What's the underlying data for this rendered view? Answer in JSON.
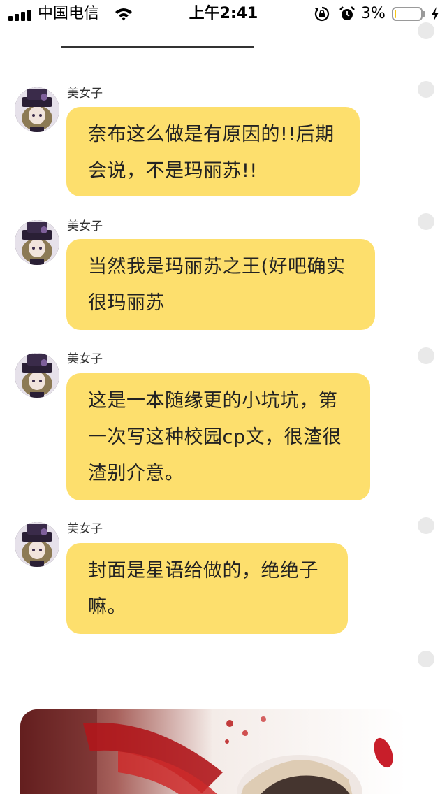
{
  "status_bar": {
    "carrier": "中国电信",
    "time": "上午2:41",
    "battery_percent_text": "3%",
    "battery_level": 0.03,
    "icons": [
      "signal-icon",
      "wifi-icon",
      "orientation-lock-icon",
      "alarm-icon",
      "battery-icon",
      "charging-bolt-icon"
    ]
  },
  "messages": [
    {
      "sender": "美女子",
      "lines": [
        "奈布这么做是有原因的!!后期",
        "会说，不是玛丽苏!!"
      ]
    },
    {
      "sender": "美女子",
      "lines": [
        "当然我是玛丽苏之王(好吧确实",
        "很玛丽苏"
      ]
    },
    {
      "sender": "美女子",
      "lines": [
        "这是一本随缘更的小坑坑，第",
        "一次写这种校园cp文，很渣很",
        "渣别介意。"
      ]
    },
    {
      "sender": "美女子",
      "lines": [
        "封面是星语给做的，绝绝子",
        "嘛。"
      ]
    }
  ],
  "colors": {
    "bubble": "#fddf6d",
    "side_dot": "#e9e9e9",
    "battery_fill": "#f5c518"
  }
}
